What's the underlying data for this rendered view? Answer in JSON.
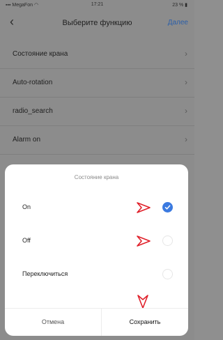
{
  "status": {
    "carrier": "MegaFon",
    "time": "17:21",
    "battery": "23 %"
  },
  "nav": {
    "back_icon": "chevron-left-icon",
    "title": "Выберите функцию",
    "next": "Далее"
  },
  "list": [
    {
      "label": "Состояние крана"
    },
    {
      "label": "Auto-rotation"
    },
    {
      "label": "radio_search"
    },
    {
      "label": "Alarm on"
    }
  ],
  "modal": {
    "title": "Состояние крана",
    "options": [
      {
        "label": "On",
        "selected": true
      },
      {
        "label": "Off",
        "selected": false
      },
      {
        "label": "Переключиться",
        "selected": false
      }
    ],
    "cancel": "Отмена",
    "save": "Сохранить"
  },
  "colors": {
    "accent": "#3b7ae0",
    "annotation_arrow": "#e0202a",
    "link": "#2c5fa8"
  }
}
